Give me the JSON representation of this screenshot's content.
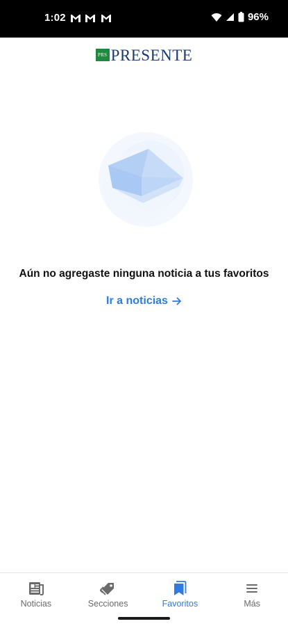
{
  "status_bar": {
    "time": "1:02",
    "battery": "96%",
    "icons": [
      "gmail-icon",
      "gmail-icon",
      "gmail-icon",
      "wifi-icon",
      "signal-icon",
      "battery-icon"
    ]
  },
  "header": {
    "logo_badge": "PRS",
    "logo_text": "PRESENTE"
  },
  "empty_state": {
    "message": "Aún no agregaste ninguna noticia a tus favoritos",
    "link_label": "Ir a noticias",
    "illustration": "envelope-illustration"
  },
  "bottom_nav": {
    "items": [
      {
        "label": "Noticias",
        "icon": "newspaper-icon",
        "active": false
      },
      {
        "label": "Secciones",
        "icon": "tags-icon",
        "active": false
      },
      {
        "label": "Favoritos",
        "icon": "bookmark-icon",
        "active": true
      },
      {
        "label": "Más",
        "icon": "menu-icon",
        "active": false
      }
    ]
  },
  "colors": {
    "accent": "#2f7be0",
    "logo_blue": "#1b3a73",
    "logo_green": "#1d8a3e",
    "inactive": "#6b6b6b"
  }
}
